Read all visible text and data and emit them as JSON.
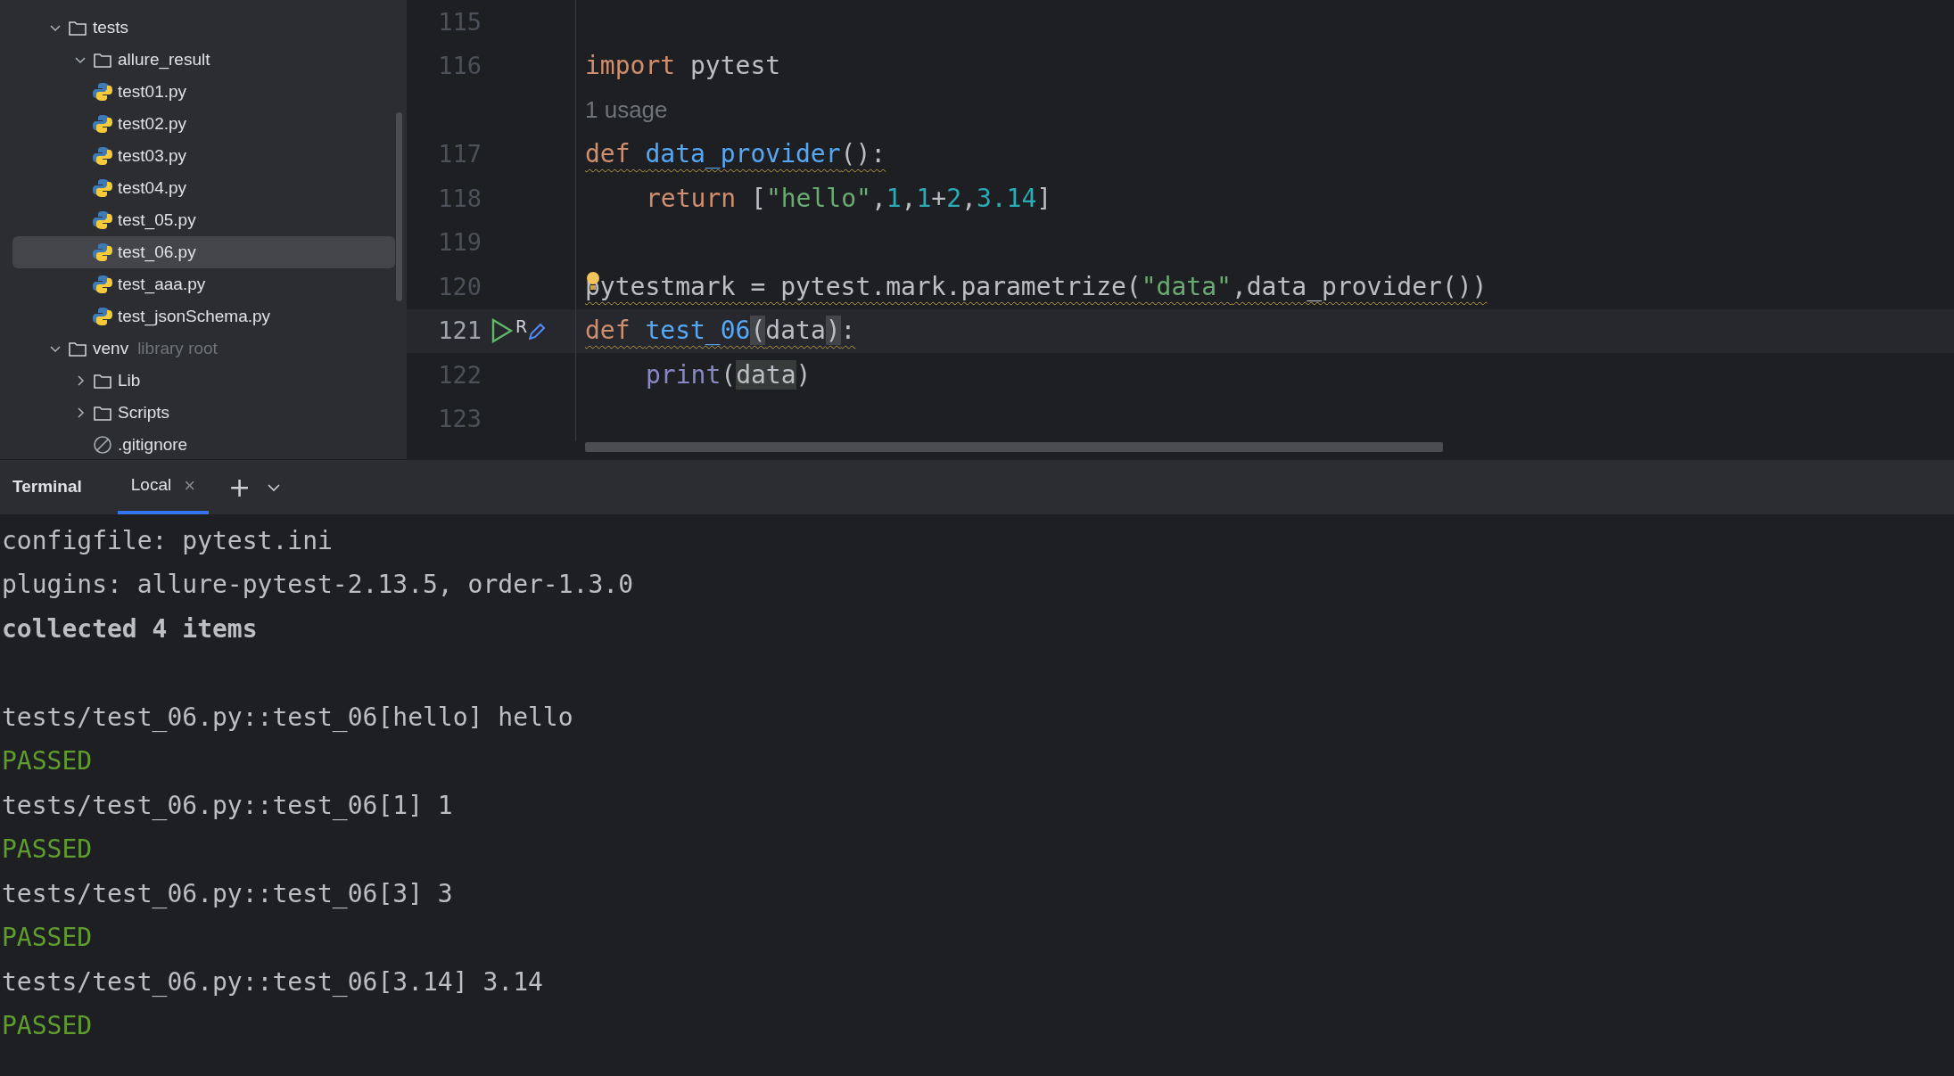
{
  "project_tree": [
    {
      "label": "tests",
      "kind": "folder",
      "expanded": true,
      "children": [
        {
          "label": "allure_result",
          "kind": "folder",
          "expanded": true
        },
        {
          "label": "test01.py",
          "kind": "python",
          "selected": false
        },
        {
          "label": "test02.py",
          "kind": "python",
          "selected": false
        },
        {
          "label": "test03.py",
          "kind": "python",
          "selected": false
        },
        {
          "label": "test04.py",
          "kind": "python",
          "selected": false
        },
        {
          "label": "test_05.py",
          "kind": "python",
          "selected": false
        },
        {
          "label": "test_06.py",
          "kind": "python",
          "selected": true
        },
        {
          "label": "test_aaa.py",
          "kind": "python",
          "selected": false
        },
        {
          "label": "test_jsonSchema.py",
          "kind": "python",
          "selected": false
        }
      ]
    },
    {
      "label": "venv",
      "hint": "library root",
      "kind": "folder",
      "expanded": true,
      "children": [
        {
          "label": "Lib",
          "kind": "folder",
          "expanded": false
        },
        {
          "label": "Scripts",
          "kind": "folder",
          "expanded": false
        },
        {
          "label": ".gitignore",
          "kind": "ignored",
          "selected": false
        }
      ]
    }
  ],
  "editor": {
    "lines": [
      {
        "number": "115"
      },
      {
        "number": "116",
        "tokens": [
          {
            "text": "import",
            "kind": "keyword"
          },
          {
            "text": " pytest",
            "kind": "plain"
          }
        ]
      },
      {
        "kind": "hint",
        "text": "1 usage"
      },
      {
        "number": "117",
        "warning": true,
        "tokens": [
          {
            "text": "def ",
            "kind": "keyword"
          },
          {
            "text": "data_provider",
            "kind": "function"
          },
          {
            "text": "():",
            "kind": "plain"
          }
        ]
      },
      {
        "number": "118",
        "indent": true,
        "tokens": [
          {
            "text": "return",
            "kind": "keyword"
          },
          {
            "text": " [",
            "kind": "plain"
          },
          {
            "text": "\"hello\"",
            "kind": "string"
          },
          {
            "text": ",",
            "kind": "plain"
          },
          {
            "text": "1",
            "kind": "number"
          },
          {
            "text": ",",
            "kind": "plain"
          },
          {
            "text": "1",
            "kind": "number"
          },
          {
            "text": "+",
            "kind": "plain"
          },
          {
            "text": "2",
            "kind": "number"
          },
          {
            "text": ",",
            "kind": "plain"
          },
          {
            "text": "3.14",
            "kind": "number"
          },
          {
            "text": "]",
            "kind": "plain"
          }
        ]
      },
      {
        "number": "119"
      },
      {
        "number": "120",
        "warning": true,
        "bulb": true,
        "tokens": [
          {
            "text": "pytestmark = pytest.mark.parametrize(",
            "kind": "plain"
          },
          {
            "text": "\"data\"",
            "kind": "string"
          },
          {
            "text": ",data_provider())",
            "kind": "plain"
          }
        ]
      },
      {
        "number": "121",
        "warning": true,
        "current": true,
        "run": true,
        "gutter_label": "R",
        "tokens": [
          {
            "text": "def ",
            "kind": "keyword"
          },
          {
            "text": "test_06",
            "kind": "function"
          },
          {
            "text": "(",
            "kind": "match"
          },
          {
            "text": "data",
            "kind": "plain"
          },
          {
            "text": ")",
            "kind": "match"
          },
          {
            "text": ":",
            "kind": "plain"
          }
        ]
      },
      {
        "number": "122",
        "indent": true,
        "tokens": [
          {
            "text": "print",
            "kind": "builtin"
          },
          {
            "text": "(",
            "kind": "plain"
          },
          {
            "text": "data",
            "kind": "usage"
          },
          {
            "text": ")",
            "kind": "plain"
          }
        ]
      },
      {
        "number": "123"
      }
    ]
  },
  "terminal": {
    "title": "Terminal",
    "tabs": [
      {
        "label": "Local",
        "selected": true,
        "close": "×"
      }
    ],
    "add": "+",
    "output": [
      {
        "text": "configfile: pytest.ini",
        "kind": "plain"
      },
      {
        "text": "plugins: allure-pytest-2.13.5, order-1.3.0",
        "kind": "plain"
      },
      {
        "text": "collected 4 items",
        "kind": "bold"
      },
      {
        "kind": "blank"
      },
      {
        "text": "tests/test_06.py::test_06[hello] hello",
        "kind": "plain"
      },
      {
        "text": "PASSED",
        "kind": "passed"
      },
      {
        "text": "tests/test_06.py::test_06[1] 1",
        "kind": "plain"
      },
      {
        "text": "PASSED",
        "kind": "passed"
      },
      {
        "text": "tests/test_06.py::test_06[3] 3",
        "kind": "plain"
      },
      {
        "text": "PASSED",
        "kind": "passed"
      },
      {
        "text": "tests/test_06.py::test_06[3.14] 3.14",
        "kind": "plain"
      },
      {
        "text": "PASSED",
        "kind": "passed"
      }
    ]
  }
}
